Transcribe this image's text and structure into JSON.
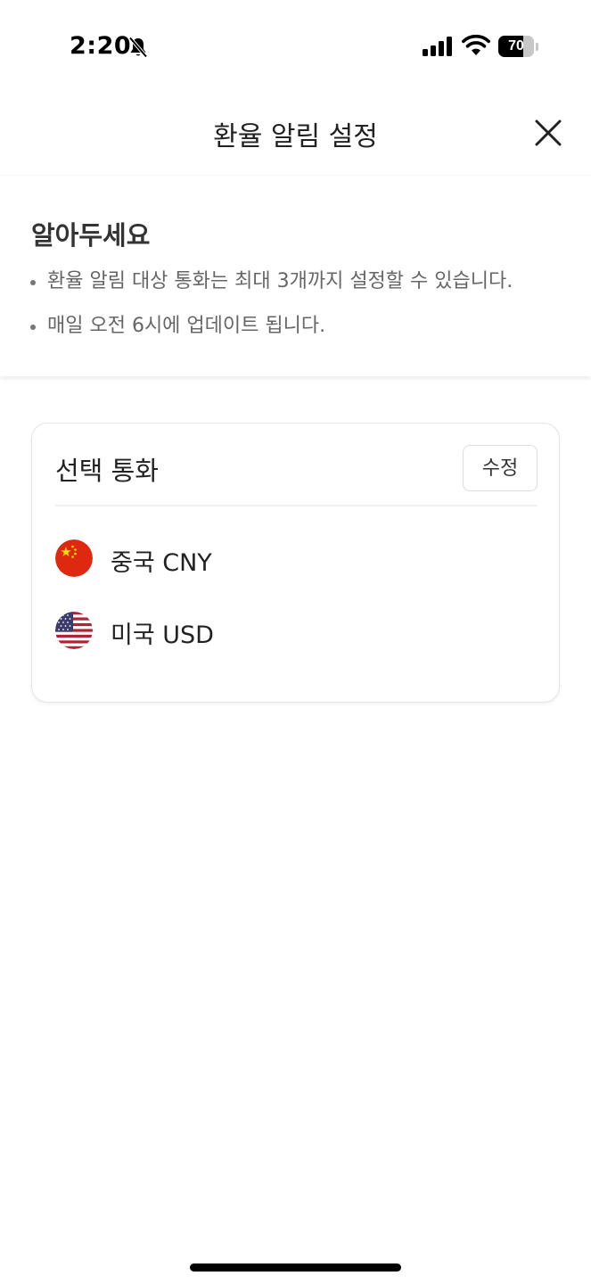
{
  "status_bar": {
    "time": "2:20",
    "battery_level": "70"
  },
  "header": {
    "title": "환율 알림 설정"
  },
  "notice": {
    "title": "알아두세요",
    "items": [
      "환율 알림 대상 통화는 최대 3개까지 설정할 수 있습니다.",
      "매일 오전 6시에 업데이트 됩니다."
    ]
  },
  "selected_currencies": {
    "title": "선택 통화",
    "edit_label": "수정",
    "items": [
      {
        "label": "중국 CNY",
        "flag": "china-flag-icon"
      },
      {
        "label": "미국 USD",
        "flag": "us-flag-icon"
      }
    ]
  },
  "colors": {
    "china_red": "#de2910",
    "china_yellow": "#ffde00",
    "us_red": "#b22234",
    "us_blue": "#3c3b6e"
  }
}
